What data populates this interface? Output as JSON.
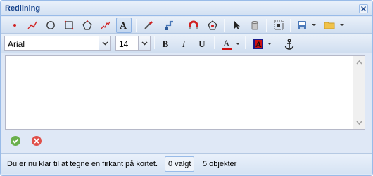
{
  "window": {
    "title": "Redlining"
  },
  "toolbar": {
    "tools": [
      {
        "name": "point-tool",
        "icon": "red-point-icon"
      },
      {
        "name": "line-tool",
        "icon": "red-polyline-icon"
      },
      {
        "name": "circle-tool",
        "icon": "circle-icon"
      },
      {
        "name": "rectangle-tool",
        "icon": "square-icon"
      },
      {
        "name": "polygon-tool",
        "icon": "polygon-icon"
      },
      {
        "name": "freehand-tool",
        "icon": "freehand-line-icon"
      },
      {
        "name": "text-tool",
        "icon": "text-a-icon",
        "active": true
      },
      {
        "name": "eyedropper-tool",
        "icon": "pipette-icon"
      },
      {
        "name": "modify-tool",
        "icon": "edit-shape-icon"
      },
      {
        "name": "snap-tool",
        "icon": "magnet-icon"
      },
      {
        "name": "vertex-tool",
        "icon": "vertex-edit-icon"
      },
      {
        "name": "select-tool",
        "icon": "pointer-icon"
      },
      {
        "name": "delete-tool",
        "icon": "trash-can-icon"
      },
      {
        "name": "grid-tool",
        "icon": "grid-select-icon"
      },
      {
        "name": "save-tool",
        "icon": "floppy-disk-icon"
      },
      {
        "name": "open-tool",
        "icon": "folder-icon"
      }
    ]
  },
  "format": {
    "font_family": "Arial",
    "font_size": "14",
    "bold_label": "B",
    "italic_label": "I",
    "underline_label": "U",
    "font_color_label": "A",
    "font_color": "#d01010",
    "highlight_label": "A",
    "highlight_color": "#d01010",
    "anchor_icon": "anchor-icon"
  },
  "editor": {
    "value": ""
  },
  "actions": {
    "ok_icon": "green-check-icon",
    "cancel_icon": "red-x-icon"
  },
  "status": {
    "message": "Du er nu klar til at tegne en firkant på kortet.",
    "selected": "0 valgt",
    "objects": "5 objekter"
  }
}
